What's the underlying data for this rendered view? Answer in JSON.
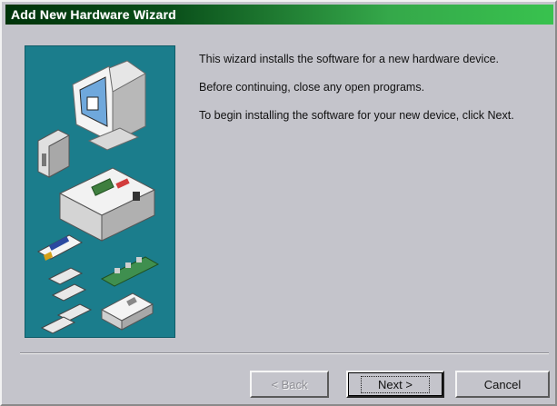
{
  "window": {
    "title": "Add New Hardware Wizard"
  },
  "content": {
    "paragraphs": [
      "This wizard installs the software for a new hardware device.",
      "Before continuing, close any open programs.",
      "To begin installing the software for your new device, click Next."
    ]
  },
  "buttons": {
    "back_label": "< Back",
    "next_label": "Next >",
    "cancel_label": "Cancel",
    "back_enabled": false
  },
  "illustration": {
    "icons": [
      "monitor-icon",
      "external-drive-icon",
      "computer-case-icon",
      "graphics-card-icon",
      "network-card-icon",
      "chip-icon",
      "modem-icon"
    ]
  },
  "colors": {
    "title_gradient_start": "#00330a",
    "title_gradient_end": "#38c24e",
    "illustration_background": "#1b7d8c",
    "dialog_background": "#c4c4cb"
  }
}
